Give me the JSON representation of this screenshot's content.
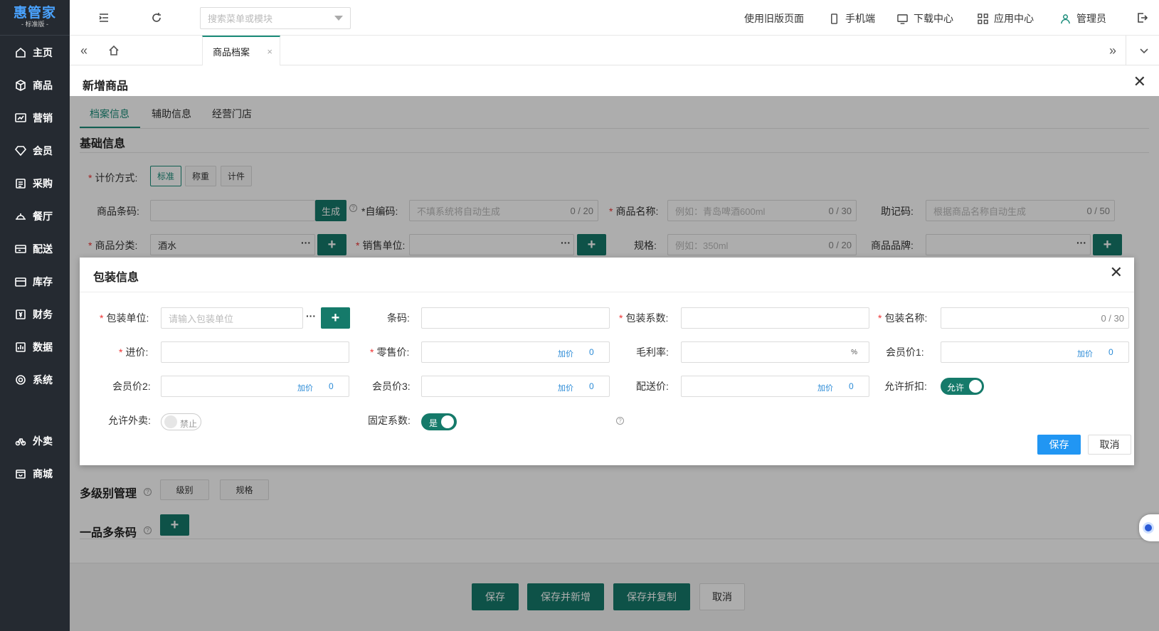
{
  "brand": {
    "name": "惠管家",
    "sub": "- 标准版 -"
  },
  "sidebar": {
    "items": [
      {
        "label": "主页",
        "icon": "home-icon"
      },
      {
        "label": "商品",
        "icon": "box-icon"
      },
      {
        "label": "营销",
        "icon": "chart-icon"
      },
      {
        "label": "会员",
        "icon": "diamond-icon"
      },
      {
        "label": "采购",
        "icon": "purchase-icon"
      },
      {
        "label": "餐厅",
        "icon": "restaurant-icon"
      },
      {
        "label": "配送",
        "icon": "delivery-icon"
      },
      {
        "label": "库存",
        "icon": "inventory-icon"
      },
      {
        "label": "财务",
        "icon": "finance-icon"
      },
      {
        "label": "数据",
        "icon": "data-icon"
      },
      {
        "label": "系统",
        "icon": "system-icon"
      },
      {
        "label": "外卖",
        "icon": "takeout-icon"
      },
      {
        "label": "商城",
        "icon": "mall-icon"
      }
    ]
  },
  "topbar": {
    "search_placeholder": "搜索菜单或模块",
    "links": {
      "old_version": "使用旧版页面",
      "mobile": "手机端",
      "downloads": "下载中心",
      "apps": "应用中心",
      "user": "管理员"
    }
  },
  "tabs": {
    "active": "商品档案",
    "close": "×"
  },
  "page": {
    "title": "新增商品",
    "close": "✕",
    "tabs": [
      "档案信息",
      "辅助信息",
      "经营门店"
    ],
    "section_basic": "基础信息",
    "pricing_label": "计价方式:",
    "pricing_options": [
      "标准",
      "称重",
      "计件"
    ],
    "barcode_label": "商品条码:",
    "generate_btn": "生成",
    "selfcode_label": "*自编码:",
    "selfcode_placeholder": "不填系统将自动生成",
    "selfcode_count": "0 / 20",
    "name_label": "商品名称:",
    "name_placeholder": "例如：青岛啤酒600ml",
    "name_count": "0 / 30",
    "mnemonic_label": "助记码:",
    "mnemonic_placeholder": "根据商品名称自动生成",
    "mnemonic_count": "0 / 50",
    "category_label": "商品分类:",
    "category_value": "酒水",
    "sale_unit_label": "销售单位:",
    "spec_label": "规格:",
    "spec_placeholder": "例如：350ml",
    "spec_count": "0 / 20",
    "brand_label": "商品品牌:",
    "multilevel_title": "多级别管理",
    "level_btn": "级别",
    "spec_btn": "规格",
    "multibarcode_title": "一品多条码",
    "footer": {
      "save": "保存",
      "save_new": "保存并新增",
      "save_copy": "保存并复制",
      "cancel": "取消"
    }
  },
  "dialog": {
    "title": "包装信息",
    "close": "✕",
    "pack_unit_label": "包装单位:",
    "pack_unit_placeholder": "请输入包装单位",
    "barcode_label": "条码:",
    "pack_factor_label": "包装系数:",
    "pack_name_label": "包装名称:",
    "pack_name_count": "0 / 30",
    "cost_label": "进价:",
    "retail_label": "零售价:",
    "margin_label": "毛利率:",
    "margin_unit": "%",
    "member1_label": "会员价1:",
    "member2_label": "会员价2:",
    "member3_label": "会员价3:",
    "delivery_label": "配送价:",
    "discount_label": "允许折扣:",
    "discount_toggle": "允许",
    "takeout_label": "允许外卖:",
    "takeout_toggle": "禁止",
    "fixed_factor_label": "固定系数:",
    "fixed_factor_toggle": "是",
    "markup_text": "加价",
    "markup_value": "0",
    "save": "保存",
    "cancel": "取消"
  }
}
